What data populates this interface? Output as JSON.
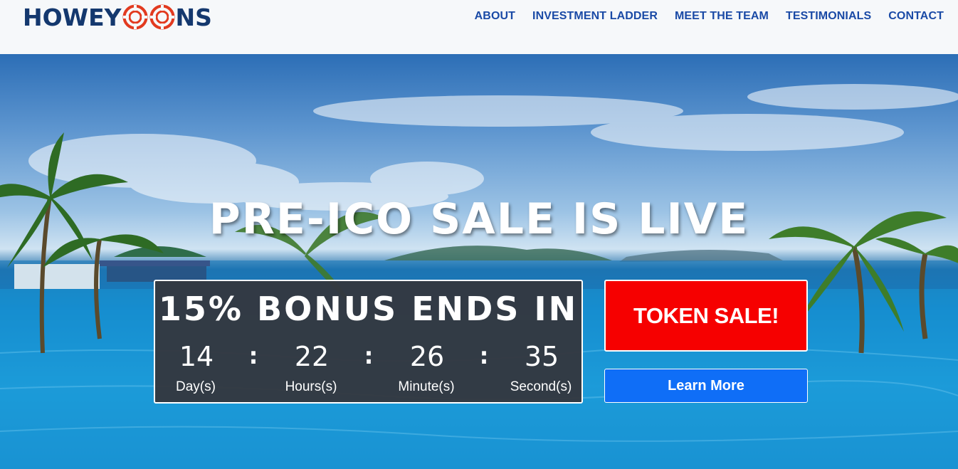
{
  "header": {
    "logo_text_left": "HOWEY",
    "logo_text_right": "NS",
    "logo_colors": {
      "text": "#14386e",
      "coin": "#e23a1f"
    },
    "nav": [
      {
        "label": "ABOUT"
      },
      {
        "label": "INVESTMENT LADDER"
      },
      {
        "label": "MEET THE TEAM"
      },
      {
        "label": "TESTIMONIALS"
      },
      {
        "label": "CONTACT"
      }
    ]
  },
  "hero": {
    "headline": "PRE-ICO SALE IS LIVE",
    "countdown": {
      "title": "15% BONUS ENDS IN",
      "days": "14",
      "hours": "22",
      "minutes": "26",
      "seconds": "35",
      "separator": ":",
      "days_label": "Day(s)",
      "hours_label": "Hours(s)",
      "minutes_label": "Minute(s)",
      "seconds_label": "Second(s)"
    },
    "token_sale_label": "TOKEN SALE!",
    "learn_more_label": "Learn More",
    "colors": {
      "token_sale": "#f60000",
      "learn_more": "#0f6ef7",
      "countdown_bg": "#343840"
    }
  }
}
